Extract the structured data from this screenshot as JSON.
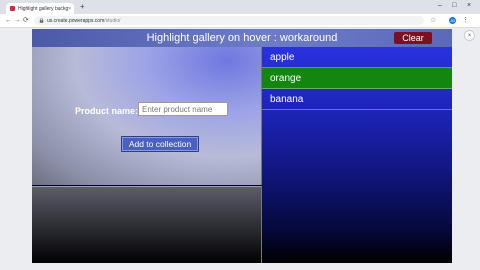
{
  "browser": {
    "tab_title": "Highlight gallery background on h...",
    "tab_close": "×",
    "new_tab": "+",
    "window_controls": [
      "–",
      "□",
      "×"
    ],
    "back": "←",
    "forward": "→",
    "reload": "⟳",
    "url_host": "us.create.powerapps.com",
    "url_path": "/studio/",
    "star": "☆",
    "avatar": "JB",
    "menu": "⋮",
    "panel_close": "×"
  },
  "app": {
    "title": "Highlight gallery on hover : workaround",
    "clear_label": "Clear",
    "product_label": "Product name:",
    "product_placeholder": "Enter product name",
    "product_value": "",
    "add_label": "Add to collection",
    "gallery": {
      "items": [
        "apple",
        "orange",
        "banana"
      ],
      "selected_index": 1,
      "selected_color": "#12860f"
    }
  }
}
